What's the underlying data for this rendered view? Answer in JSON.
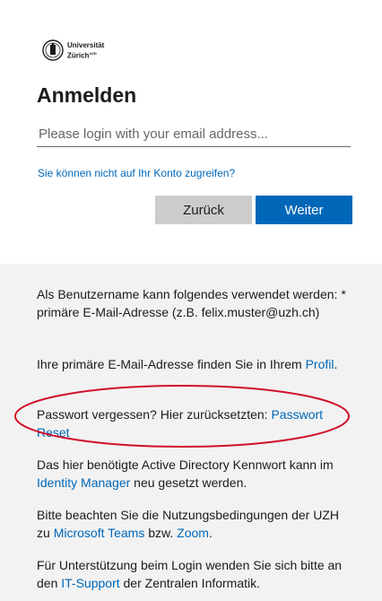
{
  "logo": {
    "line1": "Universität",
    "line2": "Zürich",
    "superscript": "UZH",
    "icon": "uzh-seal-icon"
  },
  "login": {
    "title": "Anmelden",
    "email_placeholder": "Please login with your email address...",
    "email_value": "",
    "no_access_link": "Sie können nicht auf Ihr Konto zugreifen?",
    "back_label": "Zurück",
    "next_label": "Weiter"
  },
  "info": {
    "p1": "Als Benutzername kann folgendes verwendet werden: * primäre E-Mail-Adresse (z.B. felix.muster@uzh.ch)",
    "p2_text": "Ihre primäre E-Mail-Adresse finden Sie in Ihrem ",
    "p2_link": "Profil",
    "p2_end": ".",
    "p3_text": "Passwort vergessen? Hier zurücksetzten: ",
    "p3_link": "Passwort Reset",
    "p4_text1": "Das hier benötigte Active Directory Kennwort kann im ",
    "p4_link": "Identity Manager",
    "p4_text2": " neu gesetzt werden.",
    "p5_text1": "Bitte beachten Sie die Nutzungsbedingungen der UZH zu ",
    "p5_link1": "Microsoft Teams",
    "p5_text2": " bzw. ",
    "p5_link2": "Zoom",
    "p5_end": ".",
    "p6_text1": "Für Unterstützung beim Login wenden Sie sich bitte an den ",
    "p6_link": "IT-Support",
    "p6_text2": " der Zentralen Informatik."
  },
  "colors": {
    "accent": "#0067b8",
    "annotation": "#d0102a",
    "panel": "#f2f2f2"
  }
}
